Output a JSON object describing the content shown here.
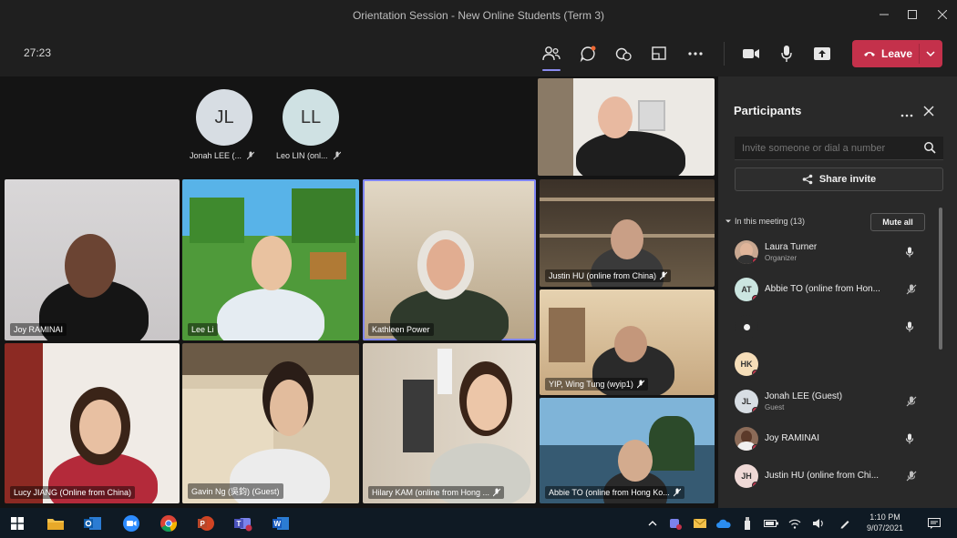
{
  "window": {
    "title": "Orientation Session - New Online Students (Term 3)",
    "controls": [
      "minimize-icon",
      "maximize-icon",
      "close-icon"
    ]
  },
  "toolbar": {
    "timer": "27:23",
    "buttons": [
      "people-icon",
      "chat-icon",
      "reactions-icon",
      "share-tray-icon",
      "more-icon",
      "camera-icon",
      "mic-icon",
      "share-screen-icon"
    ],
    "leave_label": "Leave"
  },
  "stage": {
    "avatars": [
      {
        "initials": "JL",
        "label": "Jonah LEE (..."
      },
      {
        "initials": "LL",
        "label": "Leo LIN (onl..."
      }
    ],
    "tiles": [
      {
        "label": "Joy RAMINAI"
      },
      {
        "label": "Lee Li"
      },
      {
        "label": "Kathleen Power"
      },
      {
        "label": ""
      },
      {
        "label": "Justin HU (online from China)"
      },
      {
        "label": "YIP, Wing Tung (wyip1)"
      },
      {
        "label": "Lucy JIANG (Online from China)"
      },
      {
        "label": "Gavin Ng (吳鈞) (Guest)"
      },
      {
        "label": "Hilary KAM (online from Hong ..."
      },
      {
        "label": "Abbie TO (online from Hong Ko..."
      }
    ]
  },
  "panel": {
    "title": "Participants",
    "invite_placeholder": "Invite someone or dial a number",
    "share_invite": "Share invite",
    "section_label": "In this meeting (13)",
    "mute_all": "Mute all",
    "participants": [
      {
        "initials": "",
        "name": "Laura Turner",
        "role": "Organizer",
        "mic": "mic-icon"
      },
      {
        "initials": "AT",
        "name": "Abbie TO (online from Hon...",
        "role": "",
        "mic": "mic-off-icon"
      },
      {
        "initials": "",
        "name": "",
        "role": "",
        "mic": "mic-icon"
      },
      {
        "initials": "HK",
        "name": "",
        "role": "",
        "mic": ""
      },
      {
        "initials": "JL",
        "name": "Jonah LEE (Guest)",
        "role": "Guest",
        "mic": "mic-off-icon"
      },
      {
        "initials": "",
        "name": "Joy RAMINAI",
        "role": "",
        "mic": "mic-icon"
      },
      {
        "initials": "JH",
        "name": "Justin HU (online from Chi...",
        "role": "",
        "mic": "mic-off-icon"
      }
    ]
  },
  "taskbar": {
    "time": "1:10 PM",
    "date": "9/07/2021"
  },
  "colors": {
    "accent": "#7f85f5",
    "leave": "#c4314b",
    "panel": "#292929",
    "background": "#1f1f1f"
  }
}
